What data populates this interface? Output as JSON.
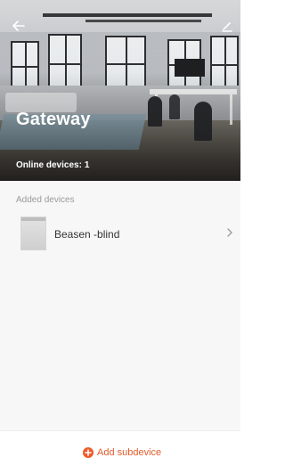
{
  "header": {
    "title": "Gateway",
    "online_label": "Online devices:",
    "online_count": "1",
    "back_icon": "arrow-left-icon",
    "edit_icon": "pencil-icon"
  },
  "main": {
    "section_label": "Added devices",
    "devices": [
      {
        "name": "Beasen -blind",
        "icon": "blind-thumbnail"
      }
    ]
  },
  "footer": {
    "add_label": "Add subdevice",
    "add_icon": "plus-circle-icon"
  },
  "colors": {
    "accent": "#ef5a2a",
    "text": "#333333",
    "muted": "#9a9a9a"
  }
}
